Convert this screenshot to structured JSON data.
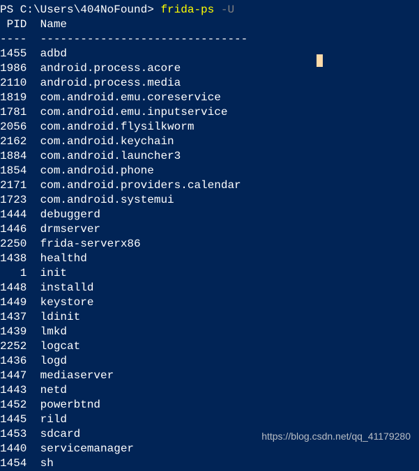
{
  "prompt": {
    "path": "PS C:\\Users\\404NoFound> ",
    "command": "frida-ps",
    "flag": " -U"
  },
  "header": {
    "pid_label": " PID",
    "name_label": "Name"
  },
  "divider": {
    "pid": "----",
    "name": "-------------------------------"
  },
  "processes": [
    {
      "pid": "1455",
      "name": "adbd"
    },
    {
      "pid": "1986",
      "name": "android.process.acore"
    },
    {
      "pid": "2110",
      "name": "android.process.media"
    },
    {
      "pid": "1819",
      "name": "com.android.emu.coreservice"
    },
    {
      "pid": "1781",
      "name": "com.android.emu.inputservice"
    },
    {
      "pid": "2056",
      "name": "com.android.flysilkworm"
    },
    {
      "pid": "2162",
      "name": "com.android.keychain"
    },
    {
      "pid": "1884",
      "name": "com.android.launcher3"
    },
    {
      "pid": "1854",
      "name": "com.android.phone"
    },
    {
      "pid": "2171",
      "name": "com.android.providers.calendar"
    },
    {
      "pid": "1723",
      "name": "com.android.systemui"
    },
    {
      "pid": "1444",
      "name": "debuggerd"
    },
    {
      "pid": "1446",
      "name": "drmserver"
    },
    {
      "pid": "2250",
      "name": "frida-serverx86"
    },
    {
      "pid": "1438",
      "name": "healthd"
    },
    {
      "pid": "   1",
      "name": "init"
    },
    {
      "pid": "1448",
      "name": "installd"
    },
    {
      "pid": "1449",
      "name": "keystore"
    },
    {
      "pid": "1437",
      "name": "ldinit"
    },
    {
      "pid": "1439",
      "name": "lmkd"
    },
    {
      "pid": "2252",
      "name": "logcat"
    },
    {
      "pid": "1436",
      "name": "logd"
    },
    {
      "pid": "1447",
      "name": "mediaserver"
    },
    {
      "pid": "1443",
      "name": "netd"
    },
    {
      "pid": "1452",
      "name": "powerbtnd"
    },
    {
      "pid": "1445",
      "name": "rild"
    },
    {
      "pid": "1453",
      "name": "sdcard"
    },
    {
      "pid": "1440",
      "name": "servicemanager"
    },
    {
      "pid": "1454",
      "name": "sh"
    }
  ],
  "watermark": "https://blog.csdn.net/qq_41179280"
}
